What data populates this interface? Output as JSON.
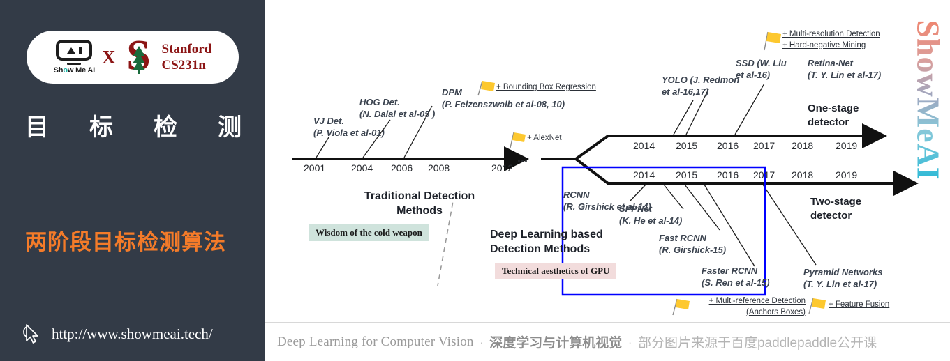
{
  "left_panel": {
    "badge": {
      "logo_text_a": "Sh",
      "logo_text_o": "o",
      "logo_text_b": "w Me AI",
      "cross": "X",
      "stanford_line1": "Stanford",
      "stanford_line2": "CS231n"
    },
    "title_chars": [
      "目",
      "标",
      "检",
      "测"
    ],
    "subtitle": "两阶段目标检测算法",
    "site_url": "http://www.showmeai.tech/"
  },
  "slide": {
    "watermark": "ShowMeAI",
    "caption": {
      "english": "Deep Learning for Computer Vision",
      "sep1": "·",
      "chinese_bold": "深度学习与计算机视觉",
      "sep2": "·",
      "chinese_tail": "部分图片来源于百度paddlepaddle公开课"
    },
    "sections": {
      "traditional": "Traditional Detection\nMethods",
      "deep_learning": "Deep Learning based\nDetection Methods",
      "wisdom_badge": "Wisdom of the cold weapon",
      "gpu_badge": "Technical aesthetics of GPU",
      "one_stage": "One-stage\ndetector",
      "two_stage": "Two-stage\ndetector",
      "ellipsis": "..."
    },
    "years": {
      "traditional": [
        "2001",
        "2004",
        "2006",
        "2008",
        "2012"
      ],
      "one_stage": [
        "2014",
        "2015",
        "2016",
        "2017",
        "2018",
        "2019"
      ],
      "two_stage": [
        "2014",
        "2015",
        "2016",
        "2017",
        "2018",
        "2019"
      ]
    },
    "methods": [
      {
        "id": "vj",
        "name": "VJ Det.\n(P. Viola et al-01)"
      },
      {
        "id": "hog",
        "name": "HOG Det.\n(N. Dalal et al-05 )"
      },
      {
        "id": "dpm",
        "name": "DPM\n(P. Felzenszwalb et al-08, 10)"
      },
      {
        "id": "yolo",
        "name": "YOLO (J. Redmon\net al-16,17)"
      },
      {
        "id": "ssd",
        "name": "SSD (W. Liu\net al-16)"
      },
      {
        "id": "retinanet",
        "name": "Retina-Net\n(T. Y. Lin et al-17)"
      },
      {
        "id": "rcnn",
        "name": "RCNN\n(R. Girshick et al-14)"
      },
      {
        "id": "sppnet",
        "name": "SPPNet\n(K. He et al-14)"
      },
      {
        "id": "fastrcnn",
        "name": "Fast RCNN\n(R. Girshick-15)"
      },
      {
        "id": "fasterrcnn",
        "name": "Faster RCNN\n(S. Ren et al-15)"
      },
      {
        "id": "pyramid",
        "name": "Pyramid Networks\n(T. Y. Lin et al-17)"
      }
    ],
    "flag_notes": [
      {
        "id": "bbox",
        "text": "+ Bounding Box Regression"
      },
      {
        "id": "alexnet",
        "text": "+ AlexNet"
      },
      {
        "id": "multires",
        "text": "+ Multi-resolution Detection\n+ Hard-negative Mining"
      },
      {
        "id": "multiref",
        "text": "+ Multi-reference Detection\n(Anchors Boxes)"
      },
      {
        "id": "featfusion",
        "text": "+ Feature Fusion"
      }
    ],
    "colors": {
      "panel_bg": "#333b47",
      "accent_orange": "#F47B29",
      "stanford_red": "#8C1515",
      "highlight_box": "#0000ff",
      "wisdom_bg": "#cfe3dc",
      "gpu_bg": "#f2dcdc",
      "flag_yellow": "#fdc82f"
    }
  }
}
